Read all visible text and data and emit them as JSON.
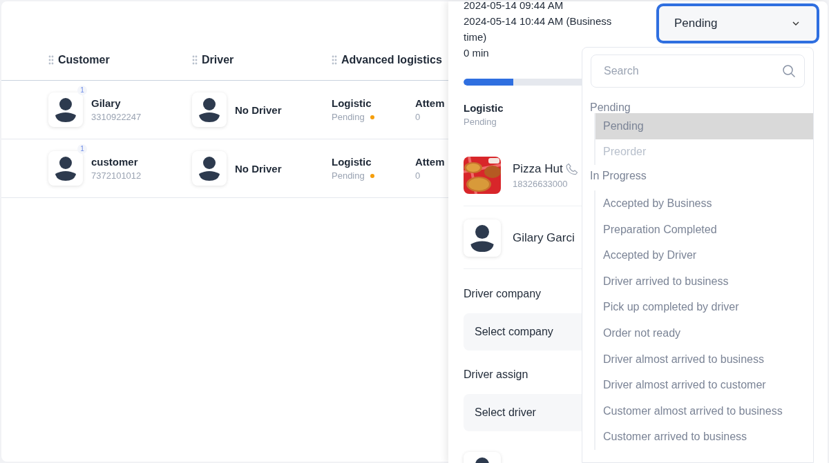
{
  "table": {
    "columns": [
      {
        "label": "Customer"
      },
      {
        "label": "Driver"
      },
      {
        "label": "Advanced logistics"
      }
    ],
    "rows": [
      {
        "customer": {
          "name": "Gilary",
          "phone": "3310922247",
          "badge": "1"
        },
        "driver": "No Driver",
        "logistic": {
          "title": "Logistic",
          "status": "Pending"
        },
        "attempts": {
          "label": "Attem",
          "value": "0"
        }
      },
      {
        "customer": {
          "name": "customer",
          "phone": "7372101012",
          "badge": "1"
        },
        "driver": "No Driver",
        "logistic": {
          "title": "Logistic",
          "status": "Pending"
        },
        "attempts": {
          "label": "Attem",
          "value": "0"
        }
      }
    ]
  },
  "panel": {
    "dates": [
      "2024-05-14 09:44 AM",
      "2024-05-14 10:44 AM (Business time)",
      "0 min"
    ],
    "progress": {
      "level": 0.3
    },
    "logistic": {
      "title": "Logistic",
      "status": "Pending"
    },
    "business": {
      "name": "Pizza Hut",
      "phone": "18326633000"
    },
    "customer": {
      "name": "Gilary Garci"
    },
    "driver_company": {
      "label": "Driver company",
      "placeholder": "Select company"
    },
    "driver_assign": {
      "label": "Driver assign",
      "placeholder": "Select driver"
    },
    "status_select": {
      "value": "Pending",
      "expanded": true
    },
    "dropdown": {
      "search": {
        "placeholder": "Search"
      },
      "groups": [
        {
          "label": "Pending",
          "options": [
            {
              "label": "Pending",
              "selected": true,
              "disabled": false
            },
            {
              "label": "Preorder",
              "selected": false,
              "disabled": true
            }
          ]
        },
        {
          "label": "In Progress",
          "options": [
            {
              "label": "Accepted by Business",
              "selected": false,
              "disabled": false
            },
            {
              "label": "Preparation Completed",
              "selected": false,
              "disabled": false
            },
            {
              "label": "Accepted by Driver",
              "selected": false,
              "disabled": false
            },
            {
              "label": "Driver arrived to business",
              "selected": false,
              "disabled": false
            },
            {
              "label": "Pick up completed by driver",
              "selected": false,
              "disabled": false
            },
            {
              "label": "Order not ready",
              "selected": false,
              "disabled": false
            },
            {
              "label": "Driver almost arrived to business",
              "selected": false,
              "disabled": false
            },
            {
              "label": "Driver almost arrived to customer",
              "selected": false,
              "disabled": false
            },
            {
              "label": "Customer almost arrived to business",
              "selected": false,
              "disabled": false
            },
            {
              "label": "Customer arrived to business",
              "selected": false,
              "disabled": false
            }
          ]
        }
      ]
    }
  }
}
